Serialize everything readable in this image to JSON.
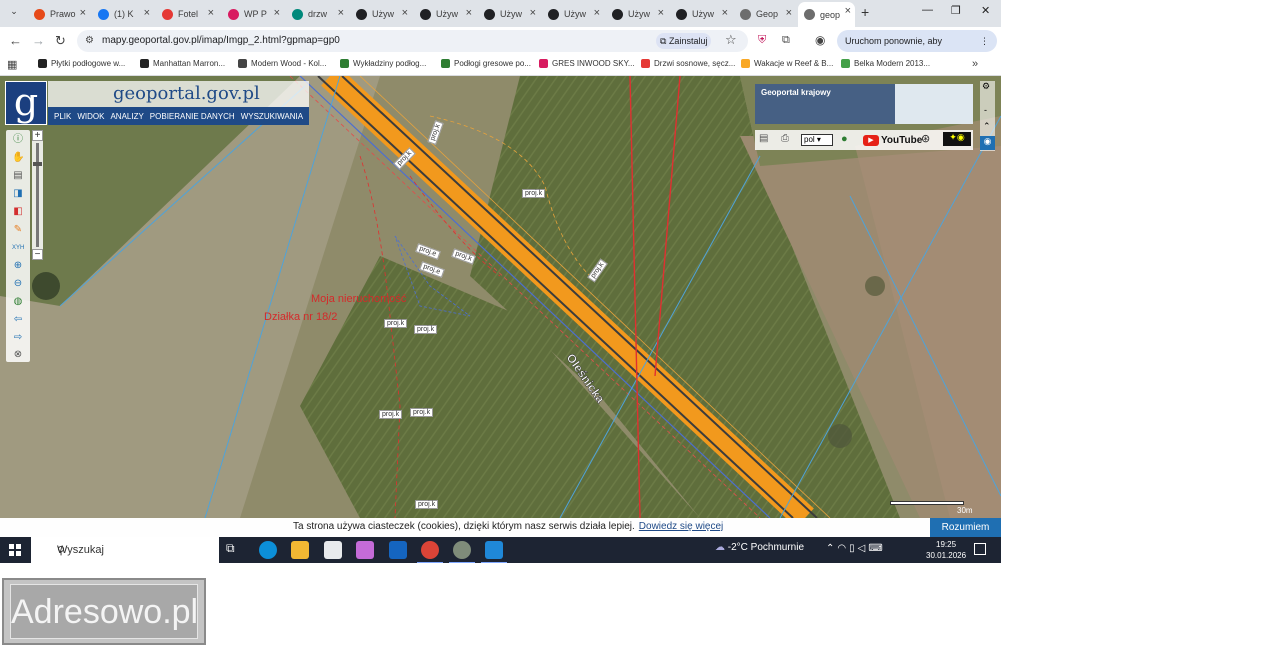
{
  "browser": {
    "tabs": [
      {
        "title": "Prawo",
        "color": "#e64a19"
      },
      {
        "title": "(1) K",
        "color": "#1877f2"
      },
      {
        "title": "Fotel",
        "color": "#e53935"
      },
      {
        "title": "WP P",
        "color": "#d81b60"
      },
      {
        "title": "drzw",
        "color": "#00897b"
      },
      {
        "title": "Używ",
        "color": "#202124"
      },
      {
        "title": "Używ",
        "color": "#202124"
      },
      {
        "title": "Używ",
        "color": "#202124"
      },
      {
        "title": "Używ",
        "color": "#202124"
      },
      {
        "title": "Używ",
        "color": "#202124"
      },
      {
        "title": "Używ",
        "color": "#202124"
      },
      {
        "title": "Geop",
        "color": "#6d6d6d"
      },
      {
        "title": "geop",
        "color": "#6d6d6d",
        "active": true
      }
    ],
    "url": "mapy.geoportal.gov.pl/imap/Imgp_2.html?gpmap=gp0",
    "install_label": "Zainstaluj",
    "relaunch_label": "Uruchom ponownie, aby zaktualizować"
  },
  "bookmarks": [
    {
      "label": "Płytki podłogowe w...",
      "color": "#222"
    },
    {
      "label": "Manhattan Marron...",
      "color": "#222"
    },
    {
      "label": "Modern Wood - Kol...",
      "color": "#444"
    },
    {
      "label": "Wykładziny podłog...",
      "color": "#2e7d32"
    },
    {
      "label": "Podłogi gresowe po...",
      "color": "#2e7d32"
    },
    {
      "label": "GRES INWOOD SKY...",
      "color": "#d81b60"
    },
    {
      "label": "Drzwi sosnowe, sęcz...",
      "color": "#e53935"
    },
    {
      "label": "Wakacje w Reef & B...",
      "color": "#f9a825"
    },
    {
      "label": "Belka Modern 2013...",
      "color": "#43a047"
    }
  ],
  "geoportal": {
    "logo_letter": "g",
    "site_name": "geoportal.gov.pl",
    "menu": [
      "PLIK",
      "WIDOK",
      "ANALIZY",
      "POBIERANIE DANYCH",
      "WYSZUKIWANIA"
    ],
    "overview_title": "Geoportal krajowy",
    "language": "pol",
    "youtube_label": "YouTube",
    "annotations": {
      "property": "Moja nieruchomość",
      "parcel": "Działka nr 18/2"
    },
    "street_name": "Oleśnicka",
    "road_tags": [
      "proj.k",
      "proj.k",
      "proj.k",
      "proj.e",
      "proj.e",
      "proj.k",
      "proj.k",
      "proj.k",
      "proj.k",
      "proj.k",
      "proj.k",
      "proj.k"
    ],
    "scale_label": "30m"
  },
  "cookie": {
    "text": "Ta strona używa ciasteczek (cookies), dzięki którym nasz serwis działa lepiej.",
    "link": "Dowiedz się więcej",
    "button": "Rozumiem"
  },
  "taskbar": {
    "search_label": "Wyszukaj",
    "weather": "-2°C  Pochmurnie",
    "time": "19:25",
    "date": "30.01.2026"
  },
  "watermark": "Adresowo.pl"
}
